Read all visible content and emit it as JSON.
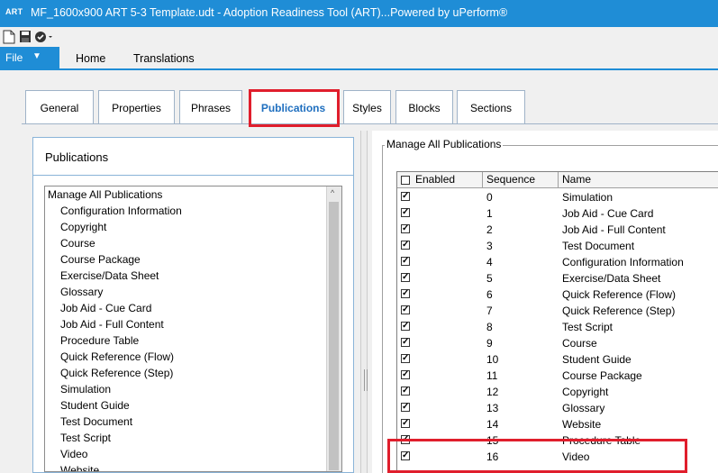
{
  "window": {
    "logo": "ART",
    "title": "MF_1600x900 ART 5-3 Template.udt - Adoption Readiness Tool (ART)...Powered by uPerform®"
  },
  "ribbon": {
    "file_label": "File",
    "tabs": [
      "Home",
      "Translations"
    ]
  },
  "page_tabs": [
    {
      "label": "General"
    },
    {
      "label": "Properties"
    },
    {
      "label": "Phrases"
    },
    {
      "label": "Publications",
      "active": true
    },
    {
      "label": "Styles"
    },
    {
      "label": "Blocks"
    },
    {
      "label": "Sections"
    }
  ],
  "left_panel": {
    "header": "Publications",
    "tree_root": "Manage All Publications",
    "tree_items": [
      "Configuration Information",
      "Copyright",
      "Course",
      "Course Package",
      "Exercise/Data Sheet",
      "Glossary",
      "Job Aid - Cue Card",
      "Job Aid - Full Content",
      "Procedure Table",
      "Quick Reference (Flow)",
      "Quick Reference (Step)",
      "Simulation",
      "Student Guide",
      "Test Document",
      "Test Script",
      "Video",
      "Website"
    ]
  },
  "right_panel": {
    "group_title": "Manage All Publications",
    "columns": [
      "Enabled",
      "Sequence",
      "Name"
    ],
    "rows": [
      {
        "enabled": true,
        "sequence": "0",
        "name": "Simulation"
      },
      {
        "enabled": true,
        "sequence": "1",
        "name": "Job Aid - Cue Card"
      },
      {
        "enabled": true,
        "sequence": "2",
        "name": "Job Aid - Full Content"
      },
      {
        "enabled": true,
        "sequence": "3",
        "name": "Test Document"
      },
      {
        "enabled": true,
        "sequence": "4",
        "name": "Configuration Information"
      },
      {
        "enabled": true,
        "sequence": "5",
        "name": "Exercise/Data Sheet"
      },
      {
        "enabled": true,
        "sequence": "6",
        "name": "Quick Reference (Flow)"
      },
      {
        "enabled": true,
        "sequence": "7",
        "name": "Quick Reference (Step)"
      },
      {
        "enabled": true,
        "sequence": "8",
        "name": "Test Script"
      },
      {
        "enabled": true,
        "sequence": "9",
        "name": "Course"
      },
      {
        "enabled": true,
        "sequence": "10",
        "name": "Student Guide"
      },
      {
        "enabled": true,
        "sequence": "11",
        "name": "Course Package"
      },
      {
        "enabled": true,
        "sequence": "12",
        "name": "Copyright"
      },
      {
        "enabled": true,
        "sequence": "13",
        "name": "Glossary"
      },
      {
        "enabled": true,
        "sequence": "14",
        "name": "Website"
      },
      {
        "enabled": true,
        "sequence": "15",
        "name": "Procedure Table"
      },
      {
        "enabled": true,
        "sequence": "16",
        "name": "Video"
      }
    ]
  },
  "colors": {
    "accent": "#1f8dd6",
    "highlight": "#e01e2c",
    "active_tab_text": "#1f6fbf"
  }
}
